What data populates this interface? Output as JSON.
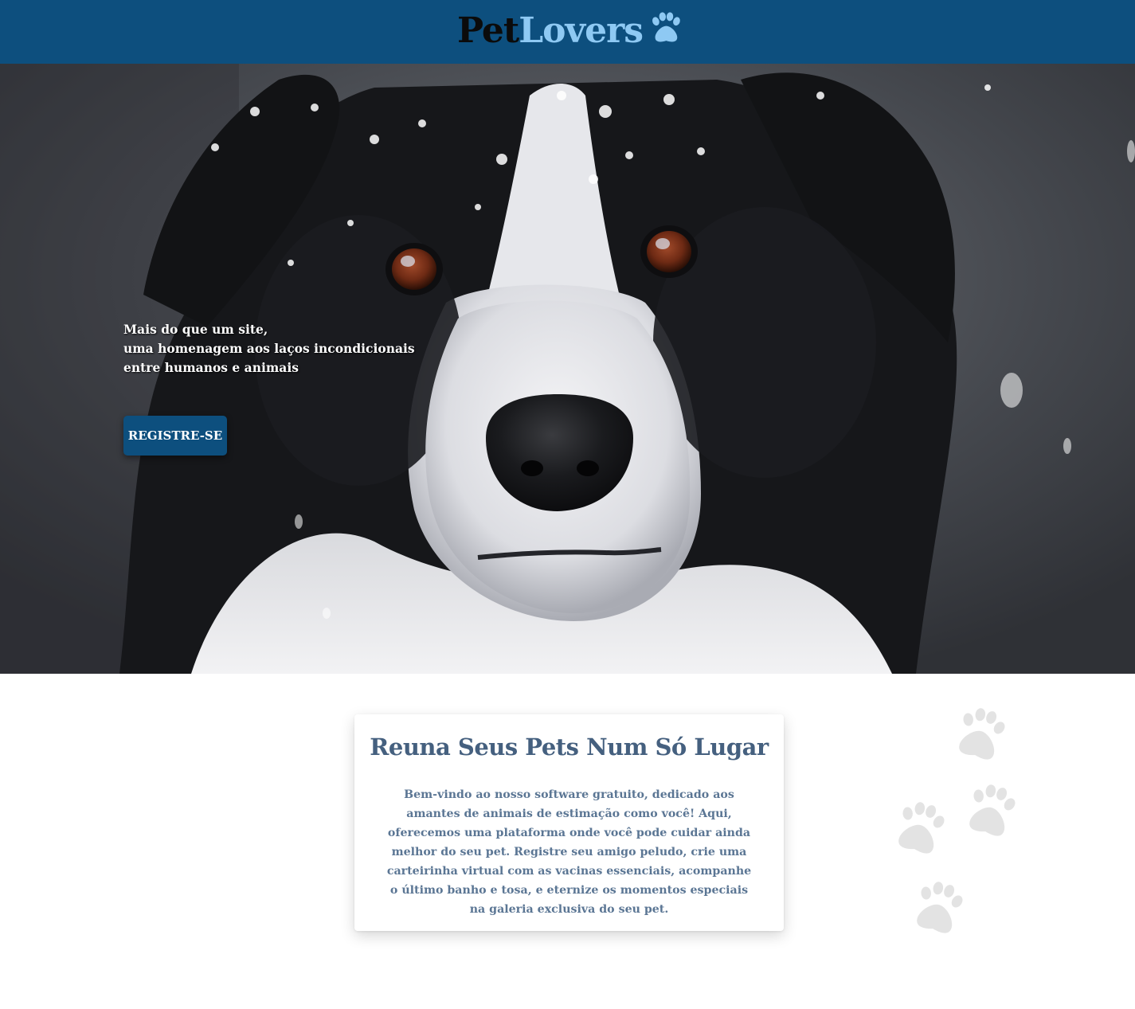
{
  "header": {
    "logo_part1": "Pet",
    "logo_part2": "Lovers",
    "logo_icon": "paw-icon",
    "brand_color": "#0d4f7e",
    "logo_accent_color": "#8ec9f3"
  },
  "hero": {
    "image": "dog-photo",
    "tagline_line1": "Mais do que um site,",
    "tagline_line2": "uma homenagem aos laços incondicionais",
    "tagline_line3": "entre humanos e animais",
    "register_label": "REGISTRE-SE"
  },
  "about": {
    "title": "Reuna Seus Pets Num Só Lugar",
    "body": "Bem-vindo ao nosso software gratuito, dedicado aos amantes de animais de estimação como você! Aqui, oferecemos uma plataforma onde você pode cuidar ainda melhor do seu pet. Registre seu amigo peludo, crie uma carteirinha virtual com as vacinas essenciais, acompanhe o último banho e tosa, e eternize os momentos especiais na galeria exclusiva do seu pet.",
    "text_color": "#5b7694",
    "title_color": "#45607f"
  },
  "decoration": {
    "icon": "paw-icon",
    "color": "#e3e3e3"
  }
}
